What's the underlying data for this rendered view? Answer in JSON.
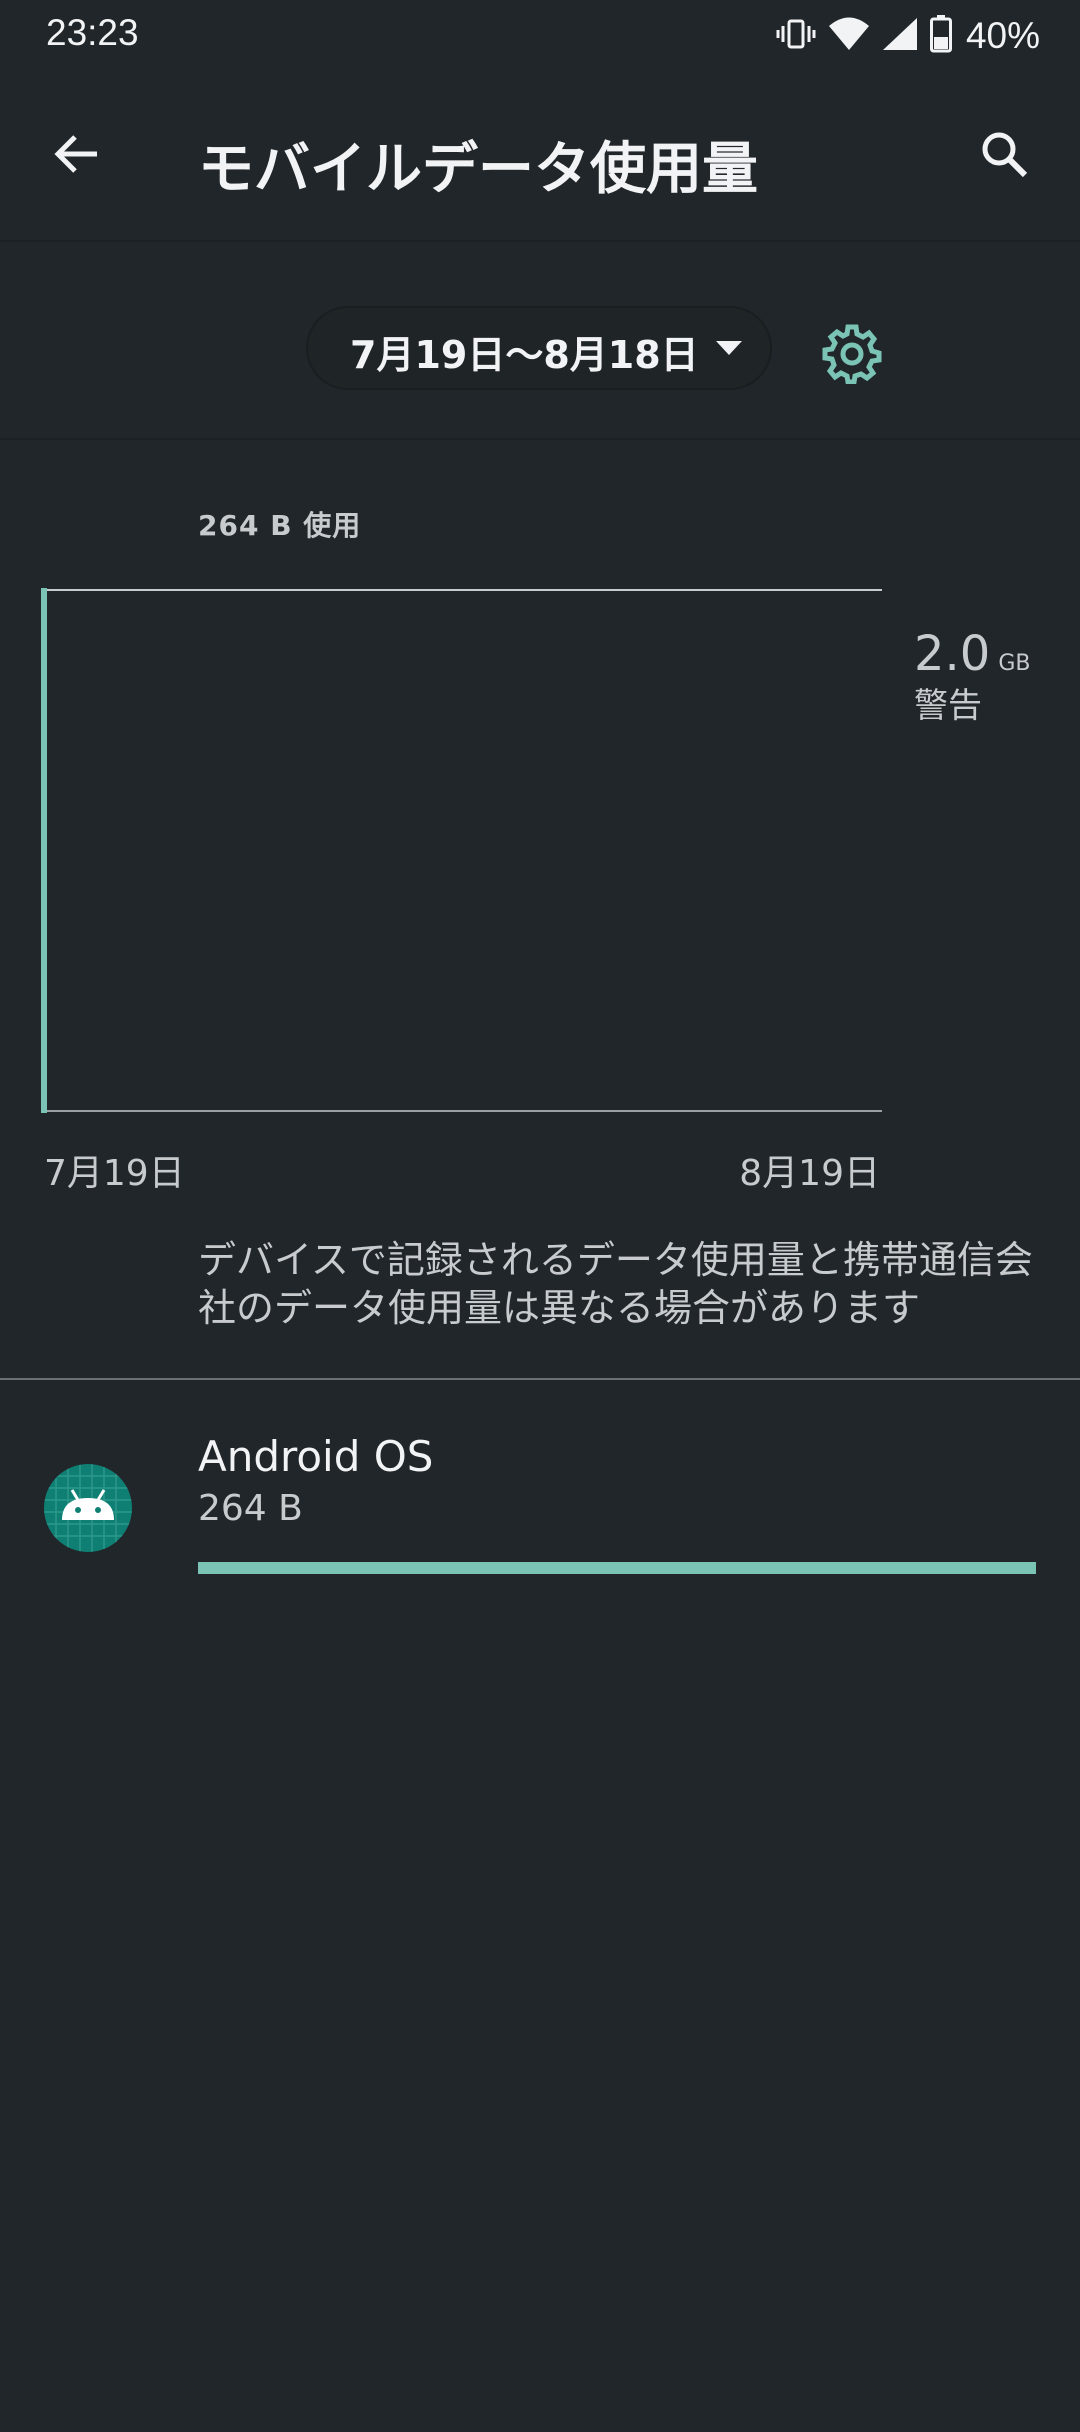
{
  "status_bar": {
    "time": "23:23",
    "battery_percent": "40%",
    "icons": [
      "vibrate-icon",
      "wifi-icon",
      "cell-signal-icon",
      "battery-icon"
    ]
  },
  "app_bar": {
    "title": "モバイルデータ使用量",
    "back_icon": "arrow-back-icon",
    "search_icon": "search-icon"
  },
  "cycle": {
    "label": "7月19日〜8月18日",
    "dropdown_icon": "caret-down-icon",
    "settings_icon": "gear-icon"
  },
  "usage": {
    "summary": "264 B 使用"
  },
  "chart_data": {
    "type": "line",
    "x_start_label": "7月19日",
    "x_end_label": "8月19日",
    "warning_value": "2.0",
    "warning_unit": "GB",
    "warning_label": "警告",
    "usage_fraction": 0.0
  },
  "notice": "デバイスで記録されるデータ使用量と携帯通信会社のデータ使用量は異なる場合があります",
  "apps": [
    {
      "name": "Android OS",
      "usage": "264 B",
      "icon": "android-icon",
      "bar_fraction": 1.0
    }
  ],
  "colors": {
    "background": "#21262a",
    "accent": "#7bc4b5",
    "text_primary": "#f1f3f4",
    "text_secondary": "#c7cbce",
    "app_icon_bg": "#0f7f73"
  }
}
